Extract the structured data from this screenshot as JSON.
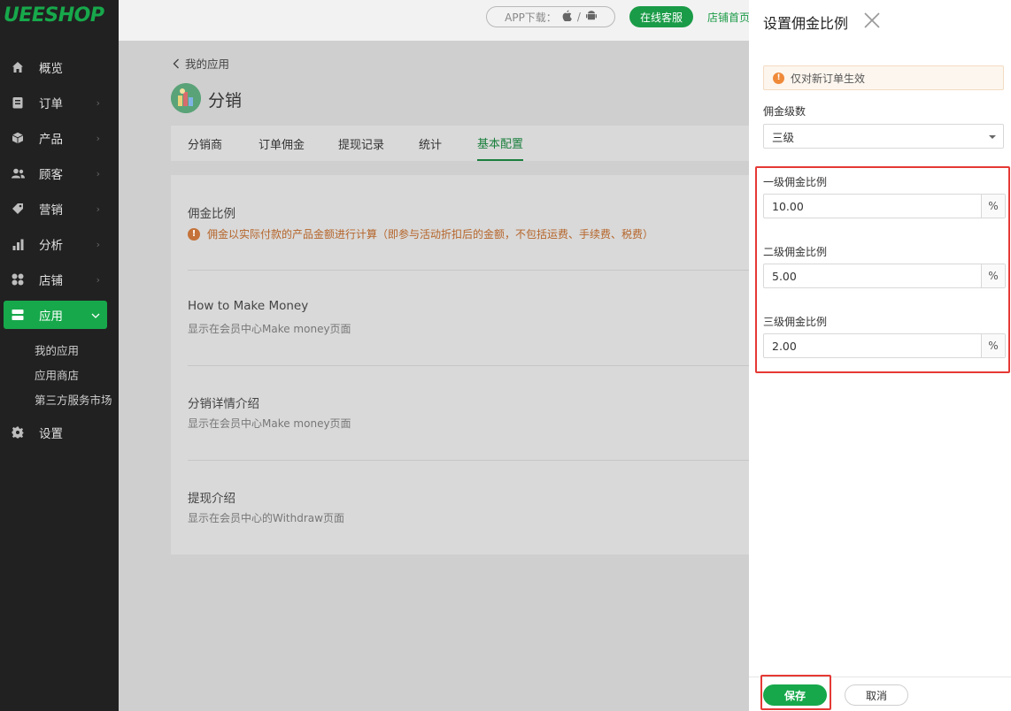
{
  "brand": {
    "logo": "UEESHOP",
    "accent": "#17a84b"
  },
  "sidebar": {
    "items": [
      {
        "label": "概览",
        "icon": "home-icon"
      },
      {
        "label": "订单",
        "icon": "order-icon"
      },
      {
        "label": "产品",
        "icon": "box-icon"
      },
      {
        "label": "顾客",
        "icon": "users-icon"
      },
      {
        "label": "营销",
        "icon": "tag-icon"
      },
      {
        "label": "分析",
        "icon": "chart-icon"
      },
      {
        "label": "店铺",
        "icon": "grid-icon"
      },
      {
        "label": "应用",
        "icon": "app-icon"
      },
      {
        "label": "设置",
        "icon": "gear-icon"
      }
    ],
    "sub_items": [
      "我的应用",
      "应用商店",
      "第三方服务市场"
    ]
  },
  "topbar": {
    "app_download": "APP下载：",
    "online_service": "在线客服",
    "shop_home": "店铺首页"
  },
  "page": {
    "back_label": "我的应用",
    "app_title": "分销",
    "tabs": [
      "分销商",
      "订单佣金",
      "提现记录",
      "统计",
      "基本配置"
    ],
    "active_tab": "基本配置",
    "sections": [
      {
        "title": "佣金比例",
        "warning": "佣金以实际付款的产品金额进行计算（即参与活动折扣后的金额，不包括运费、手续费、税费）"
      },
      {
        "title": "How to Make Money",
        "desc": "显示在会员中心Make money页面"
      },
      {
        "title": "分销详情介绍",
        "desc": "显示在会员中心Make money页面"
      },
      {
        "title": "提现介绍",
        "desc": "显示在会员中心的Withdraw页面"
      }
    ]
  },
  "drawer": {
    "title": "设置佣金比例",
    "notice": "仅对新订单生效",
    "level_label": "佣金级数",
    "level_value": "三级",
    "rates": [
      {
        "label": "一级佣金比例",
        "value": "10.00",
        "suffix": "%"
      },
      {
        "label": "二级佣金比例",
        "value": "5.00",
        "suffix": "%"
      },
      {
        "label": "三级佣金比例",
        "value": "2.00",
        "suffix": "%"
      }
    ],
    "save_label": "保存",
    "cancel_label": "取消"
  }
}
